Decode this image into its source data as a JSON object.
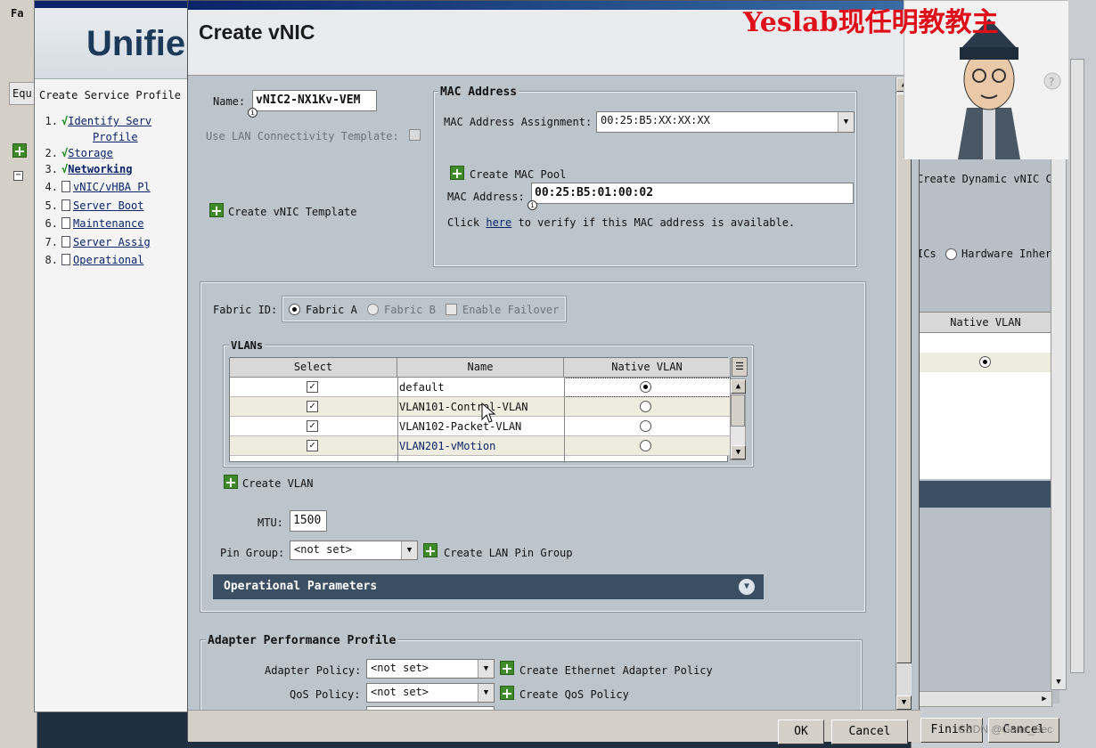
{
  "outer_left": {
    "tab_a": "Fa",
    "tab_b": "Equ"
  },
  "service_window": {
    "title": "Create Service Pr",
    "banner": "Unifie",
    "heading": "Create Service Profile",
    "steps": [
      {
        "num": "1.",
        "label": "Identify Serv",
        "label2": "Profile",
        "done": true
      },
      {
        "num": "2.",
        "label": "Storage",
        "done": true
      },
      {
        "num": "3.",
        "label": "Networking",
        "done": true,
        "current": true
      },
      {
        "num": "4.",
        "label": "vNIC/vHBA Pl",
        "done": false
      },
      {
        "num": "5.",
        "label": "Server Boot",
        "done": false
      },
      {
        "num": "6.",
        "label": "Maintenance",
        "done": false
      },
      {
        "num": "7.",
        "label": "Server Assig",
        "done": false
      },
      {
        "num": "8.",
        "label": "Operational",
        "done": false
      }
    ]
  },
  "dialog": {
    "titlebar": "Create vNIC",
    "title": "Create vNIC",
    "name_label": "Name:",
    "name_value": "vNIC2-NX1Kv-VEM",
    "lan_template_label": "Use LAN Connectivity Template:",
    "create_vnic_template": "Create vNIC Template",
    "mac": {
      "group_title": "MAC Address",
      "assignment_label": "MAC Address Assignment:",
      "assignment_value": "00:25:B5:XX:XX:XX",
      "create_mac_pool": "Create MAC Pool",
      "address_label": "MAC Address:",
      "address_value": "00:25:B5:01:00:02",
      "verify_prefix": "Click",
      "verify_link": "here",
      "verify_suffix": "to verify if this MAC address is available."
    },
    "fabric": {
      "label": "Fabric ID:",
      "option_a": "Fabric A",
      "option_b": "Fabric B",
      "failover": "Enable Failover",
      "selected": "Fabric A"
    },
    "vlans": {
      "group_title": "VLANs",
      "columns": [
        "Select",
        "Name",
        "Native VLAN"
      ],
      "rows": [
        {
          "selected": true,
          "name": "default",
          "native": true
        },
        {
          "selected": true,
          "name": "VLAN101-Control-VLAN",
          "native": false
        },
        {
          "selected": true,
          "name": "VLAN102-Packet-VLAN",
          "native": false
        },
        {
          "selected": true,
          "name": "VLAN201-vMotion",
          "native": false
        }
      ]
    },
    "create_vlan": "Create VLAN",
    "mtu_label": "MTU:",
    "mtu_value": "1500",
    "pin_group_label": "Pin Group:",
    "pin_group_value": "<not set>",
    "create_lan_pin_group": "Create LAN Pin Group",
    "operational_parameters": "Operational Parameters",
    "adapter": {
      "group_title": "Adapter Performance Profile",
      "adapter_policy_label": "Adapter Policy:",
      "adapter_policy_value": "<not set>",
      "create_adapter_policy": "Create Ethernet Adapter Policy",
      "qos_policy_label": "QoS Policy:",
      "qos_policy_value": "<not set>",
      "create_qos_policy": "Create QoS Policy"
    },
    "buttons": {
      "ok": "OK",
      "cancel": "Cancel"
    }
  },
  "right_window": {
    "create_dynamic": "Create Dynamic vNIC C",
    "hardware_label": "ICs",
    "hardware_option": "Hardware Inher",
    "native_vlan_header": "Native VLAN",
    "finish": "Finish",
    "cancel": "Cancel"
  },
  "overlay": {
    "watermark": "Yeslab现任明教教主",
    "csdn": "CSDN @Gene_Sec"
  }
}
